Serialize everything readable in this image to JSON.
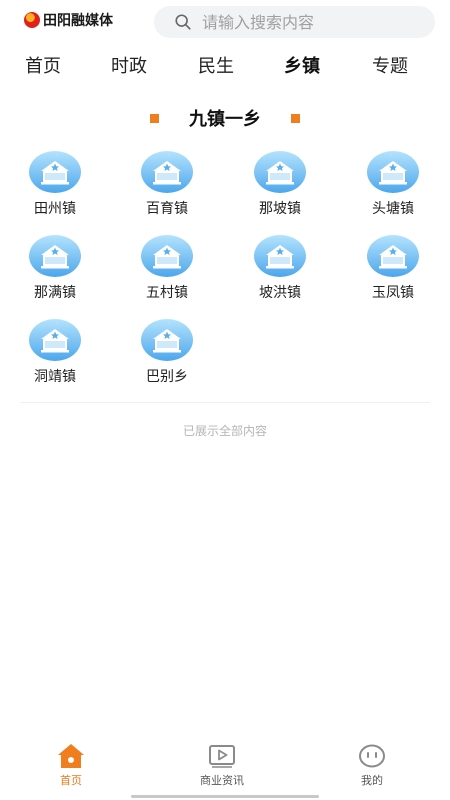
{
  "app": {
    "brand_name": "田阳融媒体"
  },
  "search": {
    "placeholder": "请输入搜索内容",
    "icon": "search-icon"
  },
  "tabs": [
    {
      "label": "首页",
      "active": false
    },
    {
      "label": "时政",
      "active": false
    },
    {
      "label": "民生",
      "active": false
    },
    {
      "label": "乡镇",
      "active": true
    },
    {
      "label": "专题",
      "active": false
    }
  ],
  "section": {
    "title": "九镇一乡"
  },
  "towns": [
    {
      "name": "田州镇"
    },
    {
      "name": "百育镇"
    },
    {
      "name": "那坡镇"
    },
    {
      "name": "头塘镇"
    },
    {
      "name": "那满镇"
    },
    {
      "name": "五村镇"
    },
    {
      "name": "坡洪镇"
    },
    {
      "name": "玉凤镇"
    },
    {
      "name": "洞靖镇"
    },
    {
      "name": "巴别乡"
    }
  ],
  "list_end_text": "已展示全部内容",
  "bottom_nav": [
    {
      "label": "首页",
      "icon": "home-icon",
      "active": true
    },
    {
      "label": "商业资讯",
      "icon": "video-icon",
      "active": false
    },
    {
      "label": "我的",
      "icon": "face-icon",
      "active": false
    }
  ],
  "colors": {
    "accent": "#f07d1e",
    "icon_blue_light": "#a8dcfb",
    "icon_blue_dark": "#4aa8ec"
  }
}
